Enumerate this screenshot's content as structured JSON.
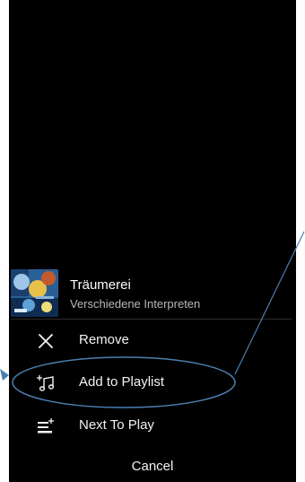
{
  "song": {
    "title": "Träumerei",
    "artist": "Verschiedene Interpreten",
    "album_art_icon": "album-art-thumbnail"
  },
  "menu": {
    "items": [
      {
        "label": "Remove",
        "icon": "close-icon"
      },
      {
        "label": "Add to Playlist",
        "icon": "add-to-playlist-icon"
      },
      {
        "label": "Next To Play",
        "icon": "queue-next-icon"
      }
    ],
    "cancel_label": "Cancel"
  },
  "colors": {
    "screen_background": "#000000",
    "text_primary": "#f2f2f2",
    "text_secondary": "#b8b8b8",
    "annotation": "#4a7fb0"
  }
}
